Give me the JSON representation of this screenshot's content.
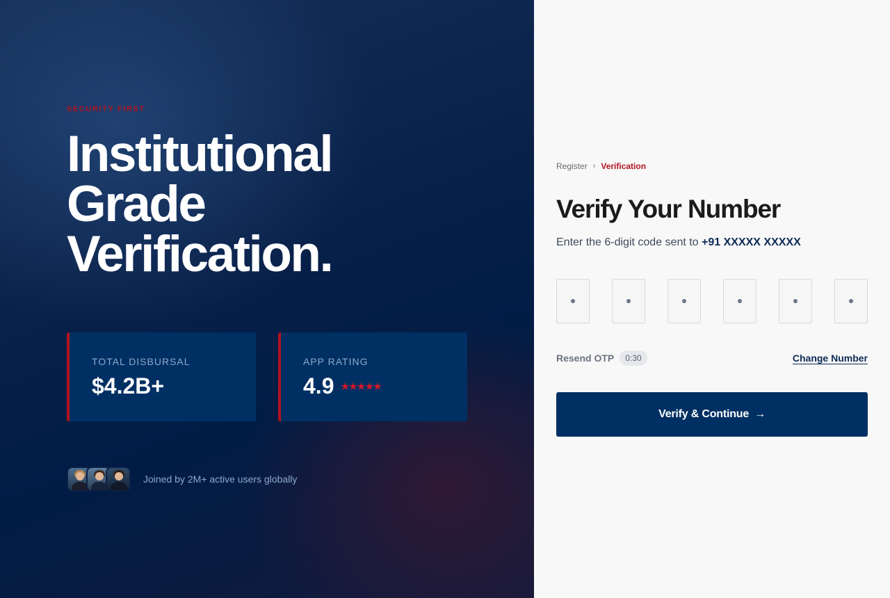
{
  "hero": {
    "eyebrow": "SECURITY FIRST",
    "title_lines": [
      "Institutional",
      "Grade",
      "Verification."
    ]
  },
  "stats": [
    {
      "label": "TOTAL DISBURSAL",
      "value": "$4.2B+"
    },
    {
      "label": "APP RATING",
      "value": "4.9",
      "stars": "★★★★★"
    }
  ],
  "social": {
    "text": "Joined by 2M+ active users globally",
    "avatars": [
      "avatar-woman",
      "avatar-man-suit",
      "avatar-man-beard"
    ]
  },
  "breadcrumb": {
    "items": [
      "Register",
      "Verification"
    ],
    "separator": "›"
  },
  "form": {
    "title": "Verify Your Number",
    "subtitle_prefix": "Enter the 6-digit code sent to ",
    "phone": "+91 XXXXX XXXXX",
    "otp_placeholder": "•",
    "resend_label": "Resend OTP",
    "timer": "0:30",
    "change_number": "Change Number",
    "submit_label": "Verify & Continue",
    "submit_icon": "→"
  },
  "colors": {
    "accent": "#b3121f",
    "primary": "#003063",
    "panel_bg": "#f8f8f8"
  }
}
